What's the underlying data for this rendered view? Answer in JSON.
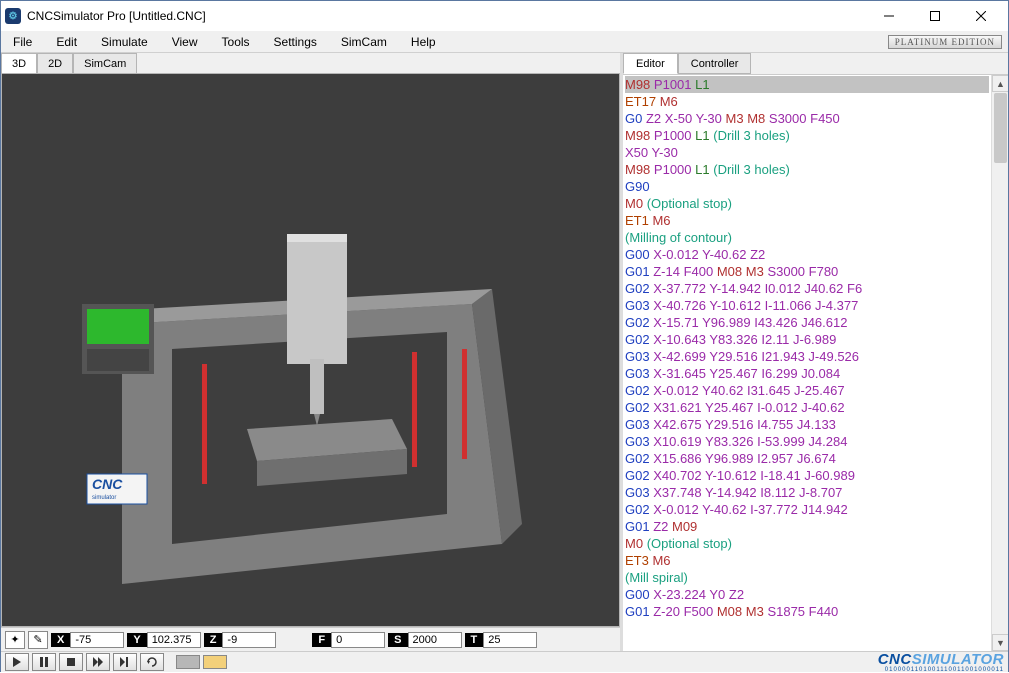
{
  "window": {
    "title": "CNCSimulator Pro [Untitled.CNC]",
    "edition_badge": "PLATINUM EDITION"
  },
  "menu": [
    "File",
    "Edit",
    "Simulate",
    "View",
    "Tools",
    "Settings",
    "SimCam",
    "Help"
  ],
  "view_tabs": [
    "3D",
    "2D",
    "SimCam"
  ],
  "active_view_tab": 0,
  "right_tabs": [
    "Editor",
    "Controller"
  ],
  "active_right_tab": 0,
  "status": {
    "tool1_icon": "crosshair-icon",
    "tool2_icon": "pencil-icon",
    "axes": [
      {
        "label": "X",
        "value": "-75"
      },
      {
        "label": "Y",
        "value": "102.375"
      },
      {
        "label": "Z",
        "value": "-9"
      }
    ],
    "params": [
      {
        "label": "F",
        "value": "0"
      },
      {
        "label": "S",
        "value": "2000"
      },
      {
        "label": "T",
        "value": "25"
      }
    ]
  },
  "playback_buttons": [
    "play",
    "pause",
    "stop",
    "fast-forward",
    "step",
    "loop"
  ],
  "swatches": [
    "#b7b7b7",
    "#f3d07a"
  ],
  "logo": {
    "text1": "CNC",
    "text2": "SIMULATOR",
    "binary": "0100001101001110011001000011"
  },
  "code_lines": [
    [
      {
        "t": "M98",
        "c": "m"
      },
      {
        "t": " "
      },
      {
        "t": "P1001",
        "c": "p"
      },
      {
        "t": " "
      },
      {
        "t": "L1",
        "c": "l"
      }
    ],
    [
      {
        "t": "ET17",
        "c": "et"
      },
      {
        "t": " "
      },
      {
        "t": "M6",
        "c": "m"
      }
    ],
    [
      {
        "t": "G0",
        "c": "g"
      },
      {
        "t": " "
      },
      {
        "t": "Z2",
        "c": "x"
      },
      {
        "t": " "
      },
      {
        "t": "X-50",
        "c": "x"
      },
      {
        "t": " "
      },
      {
        "t": "Y-30",
        "c": "x"
      },
      {
        "t": " "
      },
      {
        "t": "M3",
        "c": "m"
      },
      {
        "t": " "
      },
      {
        "t": "M8",
        "c": "m"
      },
      {
        "t": " "
      },
      {
        "t": "S3000",
        "c": "x"
      },
      {
        "t": " "
      },
      {
        "t": "F450",
        "c": "x"
      }
    ],
    [
      {
        "t": "M98",
        "c": "m"
      },
      {
        "t": " "
      },
      {
        "t": "P1000",
        "c": "p"
      },
      {
        "t": " "
      },
      {
        "t": "L1",
        "c": "l"
      },
      {
        "t": " "
      },
      {
        "t": "(Drill 3 holes)",
        "c": "c"
      }
    ],
    [
      {
        "t": "X50",
        "c": "x"
      },
      {
        "t": " "
      },
      {
        "t": "Y-30",
        "c": "x"
      }
    ],
    [
      {
        "t": "M98",
        "c": "m"
      },
      {
        "t": " "
      },
      {
        "t": "P1000",
        "c": "p"
      },
      {
        "t": " "
      },
      {
        "t": "L1",
        "c": "l"
      },
      {
        "t": " "
      },
      {
        "t": "(Drill 3 holes)",
        "c": "c"
      }
    ],
    [
      {
        "t": "G90",
        "c": "g"
      }
    ],
    [
      {
        "t": "M0",
        "c": "m"
      },
      {
        "t": " "
      },
      {
        "t": "(Optional stop)",
        "c": "c"
      }
    ],
    [
      {
        "t": "ET1",
        "c": "et"
      },
      {
        "t": " "
      },
      {
        "t": "M6",
        "c": "m"
      }
    ],
    [
      {
        "t": "(Milling of contour)",
        "c": "c"
      }
    ],
    [
      {
        "t": "G00",
        "c": "g"
      },
      {
        "t": " "
      },
      {
        "t": "X-0.012",
        "c": "x"
      },
      {
        "t": " "
      },
      {
        "t": "Y-40.62",
        "c": "x"
      },
      {
        "t": " "
      },
      {
        "t": "Z2",
        "c": "x"
      }
    ],
    [
      {
        "t": "G01",
        "c": "g"
      },
      {
        "t": " "
      },
      {
        "t": "Z-14",
        "c": "x"
      },
      {
        "t": " "
      },
      {
        "t": "F400",
        "c": "x"
      },
      {
        "t": " "
      },
      {
        "t": "M08",
        "c": "m"
      },
      {
        "t": " "
      },
      {
        "t": "M3",
        "c": "m"
      },
      {
        "t": " "
      },
      {
        "t": "S3000",
        "c": "x"
      },
      {
        "t": " "
      },
      {
        "t": "F780",
        "c": "x"
      }
    ],
    [
      {
        "t": "G02",
        "c": "g"
      },
      {
        "t": " "
      },
      {
        "t": "X-37.772",
        "c": "x"
      },
      {
        "t": " "
      },
      {
        "t": "Y-14.942",
        "c": "x"
      },
      {
        "t": " "
      },
      {
        "t": "I0.012",
        "c": "x"
      },
      {
        "t": " "
      },
      {
        "t": "J40.62",
        "c": "x"
      },
      {
        "t": " "
      },
      {
        "t": "F6",
        "c": "x"
      }
    ],
    [
      {
        "t": "G03",
        "c": "g"
      },
      {
        "t": " "
      },
      {
        "t": "X-40.726",
        "c": "x"
      },
      {
        "t": " "
      },
      {
        "t": "Y-10.612",
        "c": "x"
      },
      {
        "t": " "
      },
      {
        "t": "I-11.066",
        "c": "x"
      },
      {
        "t": " "
      },
      {
        "t": "J-4.377",
        "c": "x"
      }
    ],
    [
      {
        "t": "G02",
        "c": "g"
      },
      {
        "t": " "
      },
      {
        "t": "X-15.71",
        "c": "x"
      },
      {
        "t": " "
      },
      {
        "t": "Y96.989",
        "c": "x"
      },
      {
        "t": " "
      },
      {
        "t": "I43.426",
        "c": "x"
      },
      {
        "t": " "
      },
      {
        "t": "J46.612",
        "c": "x"
      }
    ],
    [
      {
        "t": "G02",
        "c": "g"
      },
      {
        "t": " "
      },
      {
        "t": "X-10.643",
        "c": "x"
      },
      {
        "t": " "
      },
      {
        "t": "Y83.326",
        "c": "x"
      },
      {
        "t": " "
      },
      {
        "t": "I2.11",
        "c": "x"
      },
      {
        "t": " "
      },
      {
        "t": "J-6.989",
        "c": "x"
      }
    ],
    [
      {
        "t": "G03",
        "c": "g"
      },
      {
        "t": " "
      },
      {
        "t": "X-42.699",
        "c": "x"
      },
      {
        "t": " "
      },
      {
        "t": "Y29.516",
        "c": "x"
      },
      {
        "t": " "
      },
      {
        "t": "I21.943",
        "c": "x"
      },
      {
        "t": " "
      },
      {
        "t": "J-49.526",
        "c": "x"
      }
    ],
    [
      {
        "t": "G03",
        "c": "g"
      },
      {
        "t": " "
      },
      {
        "t": "X-31.645",
        "c": "x"
      },
      {
        "t": " "
      },
      {
        "t": "Y25.467",
        "c": "x"
      },
      {
        "t": " "
      },
      {
        "t": "I6.299",
        "c": "x"
      },
      {
        "t": " "
      },
      {
        "t": "J0.084",
        "c": "x"
      }
    ],
    [
      {
        "t": "G02",
        "c": "g"
      },
      {
        "t": " "
      },
      {
        "t": "X-0.012",
        "c": "x"
      },
      {
        "t": " "
      },
      {
        "t": "Y40.62",
        "c": "x"
      },
      {
        "t": " "
      },
      {
        "t": "I31.645",
        "c": "x"
      },
      {
        "t": " "
      },
      {
        "t": "J-25.467",
        "c": "x"
      }
    ],
    [
      {
        "t": "G02",
        "c": "g"
      },
      {
        "t": " "
      },
      {
        "t": "X31.621",
        "c": "x"
      },
      {
        "t": " "
      },
      {
        "t": "Y25.467",
        "c": "x"
      },
      {
        "t": " "
      },
      {
        "t": "I-0.012",
        "c": "x"
      },
      {
        "t": " "
      },
      {
        "t": "J-40.62",
        "c": "x"
      }
    ],
    [
      {
        "t": "G03",
        "c": "g"
      },
      {
        "t": " "
      },
      {
        "t": "X42.675",
        "c": "x"
      },
      {
        "t": " "
      },
      {
        "t": "Y29.516",
        "c": "x"
      },
      {
        "t": " "
      },
      {
        "t": "I4.755",
        "c": "x"
      },
      {
        "t": " "
      },
      {
        "t": "J4.133",
        "c": "x"
      }
    ],
    [
      {
        "t": "G03",
        "c": "g"
      },
      {
        "t": " "
      },
      {
        "t": "X10.619",
        "c": "x"
      },
      {
        "t": " "
      },
      {
        "t": "Y83.326",
        "c": "x"
      },
      {
        "t": " "
      },
      {
        "t": "I-53.999",
        "c": "x"
      },
      {
        "t": " "
      },
      {
        "t": "J4.284",
        "c": "x"
      }
    ],
    [
      {
        "t": "G02",
        "c": "g"
      },
      {
        "t": " "
      },
      {
        "t": "X15.686",
        "c": "x"
      },
      {
        "t": " "
      },
      {
        "t": "Y96.989",
        "c": "x"
      },
      {
        "t": " "
      },
      {
        "t": "I2.957",
        "c": "x"
      },
      {
        "t": " "
      },
      {
        "t": "J6.674",
        "c": "x"
      }
    ],
    [
      {
        "t": "G02",
        "c": "g"
      },
      {
        "t": " "
      },
      {
        "t": "X40.702",
        "c": "x"
      },
      {
        "t": " "
      },
      {
        "t": "Y-10.612",
        "c": "x"
      },
      {
        "t": " "
      },
      {
        "t": "I-18.41",
        "c": "x"
      },
      {
        "t": " "
      },
      {
        "t": "J-60.989",
        "c": "x"
      }
    ],
    [
      {
        "t": "G03",
        "c": "g"
      },
      {
        "t": " "
      },
      {
        "t": "X37.748",
        "c": "x"
      },
      {
        "t": " "
      },
      {
        "t": "Y-14.942",
        "c": "x"
      },
      {
        "t": " "
      },
      {
        "t": "I8.112",
        "c": "x"
      },
      {
        "t": " "
      },
      {
        "t": "J-8.707",
        "c": "x"
      }
    ],
    [
      {
        "t": "G02",
        "c": "g"
      },
      {
        "t": " "
      },
      {
        "t": "X-0.012",
        "c": "x"
      },
      {
        "t": " "
      },
      {
        "t": "Y-40.62",
        "c": "x"
      },
      {
        "t": " "
      },
      {
        "t": "I-37.772",
        "c": "x"
      },
      {
        "t": " "
      },
      {
        "t": "J14.942",
        "c": "x"
      }
    ],
    [
      {
        "t": "G01",
        "c": "g"
      },
      {
        "t": " "
      },
      {
        "t": "Z2",
        "c": "x"
      },
      {
        "t": " "
      },
      {
        "t": "M09",
        "c": "m"
      }
    ],
    [
      {
        "t": "M0",
        "c": "m"
      },
      {
        "t": " "
      },
      {
        "t": "(Optional stop)",
        "c": "c"
      }
    ],
    [
      {
        "t": "ET3",
        "c": "et"
      },
      {
        "t": " "
      },
      {
        "t": "M6",
        "c": "m"
      }
    ],
    [
      {
        "t": "(Mill spiral)",
        "c": "c"
      }
    ],
    [
      {
        "t": "G00",
        "c": "g"
      },
      {
        "t": " "
      },
      {
        "t": "X-23.224",
        "c": "x"
      },
      {
        "t": " "
      },
      {
        "t": "Y0",
        "c": "x"
      },
      {
        "t": " "
      },
      {
        "t": "Z2",
        "c": "x"
      }
    ],
    [
      {
        "t": "G01",
        "c": "g"
      },
      {
        "t": " "
      },
      {
        "t": "Z-20",
        "c": "x"
      },
      {
        "t": " "
      },
      {
        "t": "F500",
        "c": "x"
      },
      {
        "t": " "
      },
      {
        "t": "M08",
        "c": "m"
      },
      {
        "t": " "
      },
      {
        "t": "M3",
        "c": "m"
      },
      {
        "t": " "
      },
      {
        "t": "S1875",
        "c": "x"
      },
      {
        "t": " "
      },
      {
        "t": "F440",
        "c": "x"
      }
    ]
  ],
  "highlighted_line": 0
}
